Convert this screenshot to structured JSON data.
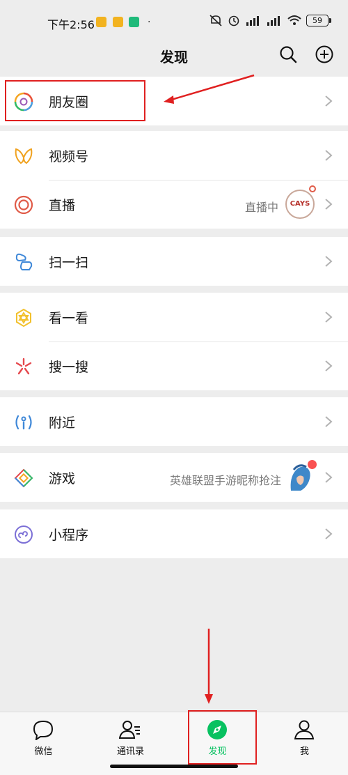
{
  "status_bar": {
    "time": "下午2:56",
    "battery": "59"
  },
  "header": {
    "title": "发现"
  },
  "menu": {
    "moments": "朋友圈",
    "channels": "视频号",
    "live": "直播",
    "live_hint": "直播中",
    "scan": "扫一扫",
    "top_stories": "看一看",
    "search": "搜一搜",
    "nearby": "附近",
    "games": "游戏",
    "games_hint": "英雄联盟手游昵称抢注",
    "mini_programs": "小程序"
  },
  "live_avatar_text": "CAYS",
  "tabs": {
    "chats": "微信",
    "contacts": "通讯录",
    "discover": "发现",
    "me": "我"
  },
  "colors": {
    "accent": "#07c160",
    "annotation_red": "#e02020"
  }
}
